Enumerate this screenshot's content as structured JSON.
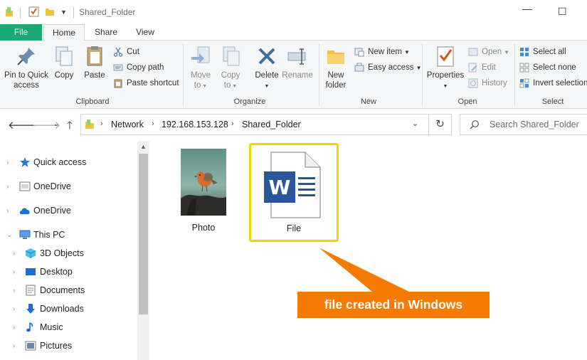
{
  "window": {
    "title": "Shared_Folder",
    "minimize_glyph": "—",
    "maximize_glyph": "☐"
  },
  "tabs": [
    {
      "label": "File"
    },
    {
      "label": "Home"
    },
    {
      "label": "Share"
    },
    {
      "label": "View"
    }
  ],
  "ribbon": {
    "clipboard": {
      "label": "Clipboard",
      "pin_label_1": "Pin to Quick",
      "pin_label_2": "access",
      "copy": "Copy",
      "paste": "Paste",
      "cut": "Cut",
      "copy_path": "Copy path",
      "paste_shortcut": "Paste shortcut"
    },
    "organize": {
      "label": "Organize",
      "move_to_1": "Move",
      "move_to_2": "to",
      "copy_to_1": "Copy",
      "copy_to_2": "to",
      "delete": "Delete",
      "rename": "Rename"
    },
    "new": {
      "label": "New",
      "new_folder_1": "New",
      "new_folder_2": "folder",
      "new_item": "New item",
      "easy_access": "Easy access"
    },
    "open": {
      "label": "Open",
      "properties": "Properties",
      "open": "Open",
      "edit": "Edit",
      "history": "History"
    },
    "select": {
      "label": "Select",
      "select_all": "Select all",
      "select_none": "Select none",
      "invert_selection": "Invert selection"
    }
  },
  "address": {
    "crumbs": [
      "Network",
      "192.168.153.128",
      "Shared_Folder"
    ],
    "search_placeholder": "Search Shared_Folder"
  },
  "navpane": {
    "items": [
      {
        "label": "Quick access",
        "icon": "star-icon"
      },
      {
        "label": "OneDrive",
        "icon": "folder-icon"
      },
      {
        "label": "OneDrive",
        "icon": "cloud-icon"
      },
      {
        "label": "This PC",
        "icon": "computer-icon"
      },
      {
        "label": "3D Objects",
        "icon": "cube-icon"
      },
      {
        "label": "Desktop",
        "icon": "desktop-icon"
      },
      {
        "label": "Documents",
        "icon": "documents-icon"
      },
      {
        "label": "Downloads",
        "icon": "download-icon"
      },
      {
        "label": "Music",
        "icon": "music-icon"
      },
      {
        "label": "Pictures",
        "icon": "pictures-icon"
      }
    ]
  },
  "files": [
    {
      "name": "Photo",
      "icon": "image-thumbnail"
    },
    {
      "name": "File",
      "icon": "word-document-icon"
    }
  ],
  "annotation": {
    "text": "file created in Windows",
    "color": "#f47a00"
  },
  "colors": {
    "file_tab": "#19a974",
    "highlight": "#f5d400",
    "word_blue": "#2b579a"
  }
}
